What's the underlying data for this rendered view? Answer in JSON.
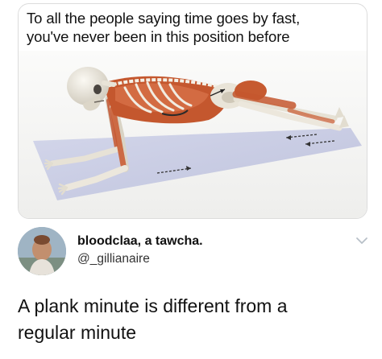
{
  "meme": {
    "caption_line1": "To all the people saying time goes by fast,",
    "caption_line2": "you've never been in this position before",
    "illustration": "anatomical-plank-skeleton-illustration"
  },
  "tweet": {
    "display_name": "bloodclaa, a tawcha.",
    "handle": "@_gillianaire",
    "text_line1": "A plank minute is different from a",
    "text_line2": "regular minute",
    "menu_icon": "chevron-down-icon"
  },
  "colors": {
    "text": "#111111",
    "handle": "#333333",
    "chevron": "#b8c0c8",
    "mat": "#c9cde4",
    "muscle": "#c4572e",
    "bone": "#eae6dc"
  }
}
